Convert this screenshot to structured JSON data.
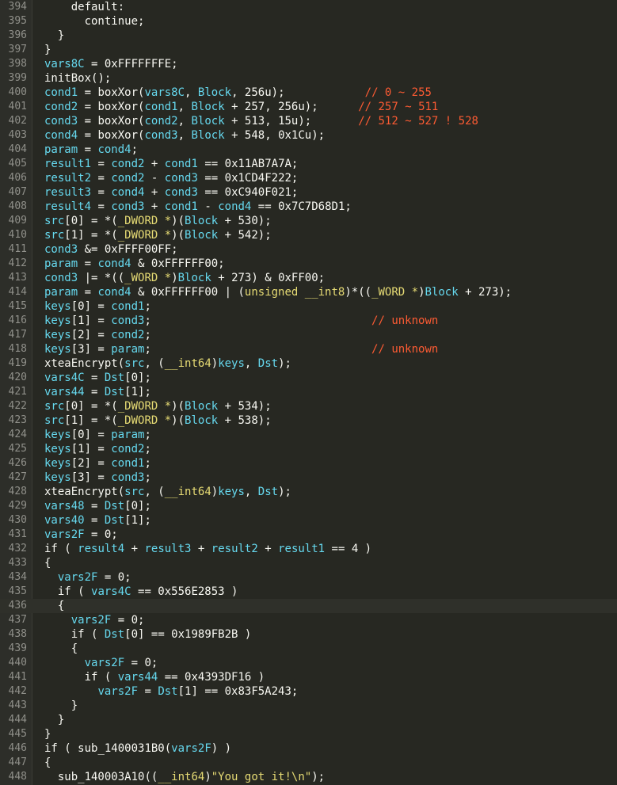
{
  "editor": {
    "current_line": 436,
    "lines": [
      {
        "n": "394",
        "seg": [
          [
            "plain",
            "    default:"
          ]
        ]
      },
      {
        "n": "395",
        "seg": [
          [
            "plain",
            "      continue;"
          ]
        ]
      },
      {
        "n": "396",
        "seg": [
          [
            "plain",
            "  }"
          ]
        ]
      },
      {
        "n": "397",
        "seg": [
          [
            "plain",
            "}"
          ]
        ]
      },
      {
        "n": "398",
        "seg": [
          [
            "var",
            "vars8C"
          ],
          [
            "plain",
            " = 0xFFFFFFFE;"
          ]
        ]
      },
      {
        "n": "399",
        "seg": [
          [
            "func",
            "initBox"
          ],
          [
            "plain",
            "();"
          ]
        ]
      },
      {
        "n": "400",
        "seg": [
          [
            "var",
            "cond1"
          ],
          [
            "plain",
            " = "
          ],
          [
            "func",
            "boxXor"
          ],
          [
            "plain",
            "("
          ],
          [
            "var",
            "vars8C"
          ],
          [
            "plain",
            ", "
          ],
          [
            "var",
            "Block"
          ],
          [
            "plain",
            ", 256u);            "
          ],
          [
            "cmt",
            "// 0 ~ 255"
          ]
        ]
      },
      {
        "n": "401",
        "seg": [
          [
            "var",
            "cond2"
          ],
          [
            "plain",
            " = "
          ],
          [
            "func",
            "boxXor"
          ],
          [
            "plain",
            "("
          ],
          [
            "var",
            "cond1"
          ],
          [
            "plain",
            ", "
          ],
          [
            "var",
            "Block"
          ],
          [
            "plain",
            " + 257, 256u);      "
          ],
          [
            "cmt",
            "// 257 ~ 511"
          ]
        ]
      },
      {
        "n": "402",
        "seg": [
          [
            "var",
            "cond3"
          ],
          [
            "plain",
            " = "
          ],
          [
            "func",
            "boxXor"
          ],
          [
            "plain",
            "("
          ],
          [
            "var",
            "cond2"
          ],
          [
            "plain",
            ", "
          ],
          [
            "var",
            "Block"
          ],
          [
            "plain",
            " + 513, 15u);       "
          ],
          [
            "cmt",
            "// 512 ~ 527 ! 528"
          ]
        ]
      },
      {
        "n": "403",
        "seg": [
          [
            "var",
            "cond4"
          ],
          [
            "plain",
            " = "
          ],
          [
            "func",
            "boxXor"
          ],
          [
            "plain",
            "("
          ],
          [
            "var",
            "cond3"
          ],
          [
            "plain",
            ", "
          ],
          [
            "var",
            "Block"
          ],
          [
            "plain",
            " + 548, 0x1Cu);"
          ]
        ]
      },
      {
        "n": "404",
        "seg": [
          [
            "var",
            "param"
          ],
          [
            "plain",
            " = "
          ],
          [
            "var",
            "cond4"
          ],
          [
            "plain",
            ";"
          ]
        ]
      },
      {
        "n": "405",
        "seg": [
          [
            "var",
            "result1"
          ],
          [
            "plain",
            " = "
          ],
          [
            "var",
            "cond2"
          ],
          [
            "plain",
            " + "
          ],
          [
            "var",
            "cond1"
          ],
          [
            "plain",
            " == 0x11AB7A7A;"
          ]
        ]
      },
      {
        "n": "406",
        "seg": [
          [
            "var",
            "result2"
          ],
          [
            "plain",
            " = "
          ],
          [
            "var",
            "cond2"
          ],
          [
            "plain",
            " - "
          ],
          [
            "var",
            "cond3"
          ],
          [
            "plain",
            " == 0x1CD4F222;"
          ]
        ]
      },
      {
        "n": "407",
        "seg": [
          [
            "var",
            "result3"
          ],
          [
            "plain",
            " = "
          ],
          [
            "var",
            "cond4"
          ],
          [
            "plain",
            " + "
          ],
          [
            "var",
            "cond3"
          ],
          [
            "plain",
            " == 0xC940F021;"
          ]
        ]
      },
      {
        "n": "408",
        "seg": [
          [
            "var",
            "result4"
          ],
          [
            "plain",
            " = "
          ],
          [
            "var",
            "cond3"
          ],
          [
            "plain",
            " + "
          ],
          [
            "var",
            "cond1"
          ],
          [
            "plain",
            " - "
          ],
          [
            "var",
            "cond4"
          ],
          [
            "plain",
            " == 0x7C7D68D1;"
          ]
        ]
      },
      {
        "n": "409",
        "seg": [
          [
            "var",
            "src"
          ],
          [
            "plain",
            "[0] = *("
          ],
          [
            "type",
            "_DWORD *"
          ],
          [
            "plain",
            ")("
          ],
          [
            "var",
            "Block"
          ],
          [
            "plain",
            " + 530);"
          ]
        ]
      },
      {
        "n": "410",
        "seg": [
          [
            "var",
            "src"
          ],
          [
            "plain",
            "[1] = *("
          ],
          [
            "type",
            "_DWORD *"
          ],
          [
            "plain",
            ")("
          ],
          [
            "var",
            "Block"
          ],
          [
            "plain",
            " + 542);"
          ]
        ]
      },
      {
        "n": "411",
        "seg": [
          [
            "var",
            "cond3"
          ],
          [
            "plain",
            " &= 0xFFFF00FF;"
          ]
        ]
      },
      {
        "n": "412",
        "seg": [
          [
            "var",
            "param"
          ],
          [
            "plain",
            " = "
          ],
          [
            "var",
            "cond4"
          ],
          [
            "plain",
            " & 0xFFFFFF00;"
          ]
        ]
      },
      {
        "n": "413",
        "seg": [
          [
            "var",
            "cond3"
          ],
          [
            "plain",
            " |= *(("
          ],
          [
            "type",
            "_WORD *"
          ],
          [
            "plain",
            ")"
          ],
          [
            "var",
            "Block"
          ],
          [
            "plain",
            " + 273) & 0xFF00;"
          ]
        ]
      },
      {
        "n": "414",
        "seg": [
          [
            "var",
            "param"
          ],
          [
            "plain",
            " = "
          ],
          [
            "var",
            "cond4"
          ],
          [
            "plain",
            " & 0xFFFFFF00 | ("
          ],
          [
            "type",
            "unsigned __int8"
          ],
          [
            "plain",
            ")*(("
          ],
          [
            "type",
            "_WORD *"
          ],
          [
            "plain",
            ")"
          ],
          [
            "var",
            "Block"
          ],
          [
            "plain",
            " + 273);"
          ]
        ]
      },
      {
        "n": "415",
        "seg": [
          [
            "var",
            "keys"
          ],
          [
            "plain",
            "[0] = "
          ],
          [
            "var",
            "cond1"
          ],
          [
            "plain",
            ";"
          ]
        ]
      },
      {
        "n": "416",
        "seg": [
          [
            "var",
            "keys"
          ],
          [
            "plain",
            "[1] = "
          ],
          [
            "var",
            "cond3"
          ],
          [
            "plain",
            ";                                 "
          ],
          [
            "cmt",
            "// unknown"
          ]
        ]
      },
      {
        "n": "417",
        "seg": [
          [
            "var",
            "keys"
          ],
          [
            "plain",
            "[2] = "
          ],
          [
            "var",
            "cond2"
          ],
          [
            "plain",
            ";"
          ]
        ]
      },
      {
        "n": "418",
        "seg": [
          [
            "var",
            "keys"
          ],
          [
            "plain",
            "[3] = "
          ],
          [
            "var",
            "param"
          ],
          [
            "plain",
            ";                                 "
          ],
          [
            "cmt",
            "// unknown"
          ]
        ]
      },
      {
        "n": "419",
        "seg": [
          [
            "func",
            "xteaEncrypt"
          ],
          [
            "plain",
            "("
          ],
          [
            "var",
            "src"
          ],
          [
            "plain",
            ", ("
          ],
          [
            "type",
            "__int64"
          ],
          [
            "plain",
            ")"
          ],
          [
            "var",
            "keys"
          ],
          [
            "plain",
            ", "
          ],
          [
            "var",
            "Dst"
          ],
          [
            "plain",
            ");"
          ]
        ]
      },
      {
        "n": "420",
        "seg": [
          [
            "var",
            "vars4C"
          ],
          [
            "plain",
            " = "
          ],
          [
            "var",
            "Dst"
          ],
          [
            "plain",
            "[0];"
          ]
        ]
      },
      {
        "n": "421",
        "seg": [
          [
            "var",
            "vars44"
          ],
          [
            "plain",
            " = "
          ],
          [
            "var",
            "Dst"
          ],
          [
            "plain",
            "[1];"
          ]
        ]
      },
      {
        "n": "422",
        "seg": [
          [
            "var",
            "src"
          ],
          [
            "plain",
            "[0] = *("
          ],
          [
            "type",
            "_DWORD *"
          ],
          [
            "plain",
            ")("
          ],
          [
            "var",
            "Block"
          ],
          [
            "plain",
            " + 534);"
          ]
        ]
      },
      {
        "n": "423",
        "seg": [
          [
            "var",
            "src"
          ],
          [
            "plain",
            "[1] = *("
          ],
          [
            "type",
            "_DWORD *"
          ],
          [
            "plain",
            ")("
          ],
          [
            "var",
            "Block"
          ],
          [
            "plain",
            " + 538);"
          ]
        ]
      },
      {
        "n": "424",
        "seg": [
          [
            "var",
            "keys"
          ],
          [
            "plain",
            "[0] = "
          ],
          [
            "var",
            "param"
          ],
          [
            "plain",
            ";"
          ]
        ]
      },
      {
        "n": "425",
        "seg": [
          [
            "var",
            "keys"
          ],
          [
            "plain",
            "[1] = "
          ],
          [
            "var",
            "cond2"
          ],
          [
            "plain",
            ";"
          ]
        ]
      },
      {
        "n": "426",
        "seg": [
          [
            "var",
            "keys"
          ],
          [
            "plain",
            "[2] = "
          ],
          [
            "var",
            "cond1"
          ],
          [
            "plain",
            ";"
          ]
        ]
      },
      {
        "n": "427",
        "seg": [
          [
            "var",
            "keys"
          ],
          [
            "plain",
            "[3] = "
          ],
          [
            "var",
            "cond3"
          ],
          [
            "plain",
            ";"
          ]
        ]
      },
      {
        "n": "428",
        "seg": [
          [
            "func",
            "xteaEncrypt"
          ],
          [
            "plain",
            "("
          ],
          [
            "var",
            "src"
          ],
          [
            "plain",
            ", ("
          ],
          [
            "type",
            "__int64"
          ],
          [
            "plain",
            ")"
          ],
          [
            "var",
            "keys"
          ],
          [
            "plain",
            ", "
          ],
          [
            "var",
            "Dst"
          ],
          [
            "plain",
            ");"
          ]
        ]
      },
      {
        "n": "429",
        "seg": [
          [
            "var",
            "vars48"
          ],
          [
            "plain",
            " = "
          ],
          [
            "var",
            "Dst"
          ],
          [
            "plain",
            "[0];"
          ]
        ]
      },
      {
        "n": "430",
        "seg": [
          [
            "var",
            "vars40"
          ],
          [
            "plain",
            " = "
          ],
          [
            "var",
            "Dst"
          ],
          [
            "plain",
            "[1];"
          ]
        ]
      },
      {
        "n": "431",
        "seg": [
          [
            "var",
            "vars2F"
          ],
          [
            "plain",
            " = 0;"
          ]
        ]
      },
      {
        "n": "432",
        "seg": [
          [
            "kw",
            "if"
          ],
          [
            "plain",
            " ( "
          ],
          [
            "var",
            "result4"
          ],
          [
            "plain",
            " + "
          ],
          [
            "var",
            "result3"
          ],
          [
            "plain",
            " + "
          ],
          [
            "var",
            "result2"
          ],
          [
            "plain",
            " + "
          ],
          [
            "var",
            "result1"
          ],
          [
            "plain",
            " == 4 )"
          ]
        ]
      },
      {
        "n": "433",
        "seg": [
          [
            "plain",
            "{"
          ]
        ]
      },
      {
        "n": "434",
        "seg": [
          [
            "plain",
            "  "
          ],
          [
            "var",
            "vars2F"
          ],
          [
            "plain",
            " = 0;"
          ]
        ]
      },
      {
        "n": "435",
        "seg": [
          [
            "plain",
            "  "
          ],
          [
            "kw",
            "if"
          ],
          [
            "plain",
            " ( "
          ],
          [
            "var",
            "vars4C"
          ],
          [
            "plain",
            " == 0x556E2853 )"
          ]
        ]
      },
      {
        "n": "436",
        "seg": [
          [
            "plain",
            "  {"
          ]
        ]
      },
      {
        "n": "437",
        "seg": [
          [
            "plain",
            "    "
          ],
          [
            "var",
            "vars2F"
          ],
          [
            "plain",
            " = 0;"
          ]
        ]
      },
      {
        "n": "438",
        "seg": [
          [
            "plain",
            "    "
          ],
          [
            "kw",
            "if"
          ],
          [
            "plain",
            " ( "
          ],
          [
            "var",
            "Dst"
          ],
          [
            "plain",
            "[0] == 0x1989FB2B )"
          ]
        ]
      },
      {
        "n": "439",
        "seg": [
          [
            "plain",
            "    {"
          ]
        ]
      },
      {
        "n": "440",
        "seg": [
          [
            "plain",
            "      "
          ],
          [
            "var",
            "vars2F"
          ],
          [
            "plain",
            " = 0;"
          ]
        ]
      },
      {
        "n": "441",
        "seg": [
          [
            "plain",
            "      "
          ],
          [
            "kw",
            "if"
          ],
          [
            "plain",
            " ( "
          ],
          [
            "var",
            "vars44"
          ],
          [
            "plain",
            " == 0x4393DF16 )"
          ]
        ]
      },
      {
        "n": "442",
        "seg": [
          [
            "plain",
            "        "
          ],
          [
            "var",
            "vars2F"
          ],
          [
            "plain",
            " = "
          ],
          [
            "var",
            "Dst"
          ],
          [
            "plain",
            "[1] == 0x83F5A243;"
          ]
        ]
      },
      {
        "n": "443",
        "seg": [
          [
            "plain",
            "    }"
          ]
        ]
      },
      {
        "n": "444",
        "seg": [
          [
            "plain",
            "  }"
          ]
        ]
      },
      {
        "n": "445",
        "seg": [
          [
            "plain",
            "}"
          ]
        ]
      },
      {
        "n": "446",
        "seg": [
          [
            "kw",
            "if"
          ],
          [
            "plain",
            " ( "
          ],
          [
            "func",
            "sub_1400031B0"
          ],
          [
            "plain",
            "("
          ],
          [
            "var",
            "vars2F"
          ],
          [
            "plain",
            ") )"
          ]
        ]
      },
      {
        "n": "447",
        "seg": [
          [
            "plain",
            "{"
          ]
        ]
      },
      {
        "n": "448",
        "seg": [
          [
            "plain",
            "  "
          ],
          [
            "func",
            "sub_140003A10"
          ],
          [
            "plain",
            "(("
          ],
          [
            "type",
            "__int64"
          ],
          [
            "plain",
            ")"
          ],
          [
            "str",
            "\"You got it!\\n\""
          ],
          [
            "plain",
            ");"
          ]
        ]
      }
    ]
  }
}
